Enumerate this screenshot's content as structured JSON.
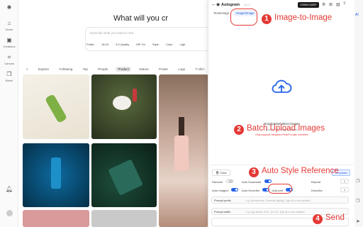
{
  "nav": {
    "items": [
      {
        "label": "Home",
        "icon": "home-icon"
      },
      {
        "label": "Creations",
        "icon": "image-icon"
      },
      {
        "label": "Canvas",
        "icon": "canvas-icon"
      },
      {
        "label": "Batch",
        "icon": "batch-icon"
      }
    ]
  },
  "main": {
    "headline": "What will you cr",
    "prompt_placeholder": "Describe what you want to see",
    "options": [
      "Public",
      "16:10",
      "3.0 Quality",
      "MP On",
      "Style",
      "Color",
      "Ligh"
    ],
    "tabs": [
      {
        "label": "Explore",
        "active": false
      },
      {
        "label": "Following",
        "active": false
      },
      {
        "label": "Top",
        "active": false
      },
      {
        "label": "People",
        "active": false
      },
      {
        "label": "Product",
        "active": true
      },
      {
        "label": "Nature",
        "active": false
      },
      {
        "label": "Poster",
        "active": false
      },
      {
        "label": "Logo",
        "active": false
      },
      {
        "label": "T-shirt",
        "active": false
      }
    ]
  },
  "panel": {
    "title": "Autogram",
    "version": "v1.0.7",
    "download_label": "DOWNLOADER",
    "tabs": [
      {
        "label": "Text2Image",
        "active": false
      },
      {
        "label": "Image2Image",
        "active": true
      }
    ],
    "upload_title": "Drop/paste/select images",
    "upload_limit": "(Limit to 500 images at once)",
    "upload_note": "Only supports Ideogram Plus/Pro plan members",
    "clear_label": "Clear",
    "templates_label": "Templates",
    "random_label": "Random",
    "auto_download_label": "Auto Download",
    "repeat_label": "Repeat",
    "repeat_value": "1",
    "auto_imagine_label": "Auto Imagine",
    "auto_describe_label": "Auto Describe",
    "add_pref_label": "Add pref",
    "describe_label": "Describe",
    "describe_value": "1",
    "prompt_prefix_label": "Prompt prefix",
    "prompt_prefix_placeholder": "e.g. Monochrome, Cinematic lighting, Type @ to use variables",
    "prompt_suffix_label": "Prompt suffix",
    "prompt_suffix_placeholder": "e.g. high details, UHD --ar 16:9, Type @ to use variables"
  },
  "annotations": [
    {
      "number": "1",
      "text": "Image-to-Image"
    },
    {
      "number": "2",
      "text": "Batch Upload Images"
    },
    {
      "number": "3",
      "text": "Auto Style Reference"
    },
    {
      "number": "4",
      "text": "Send"
    }
  ],
  "colors": {
    "accent": "#2563eb",
    "annotation": "#e53935"
  }
}
